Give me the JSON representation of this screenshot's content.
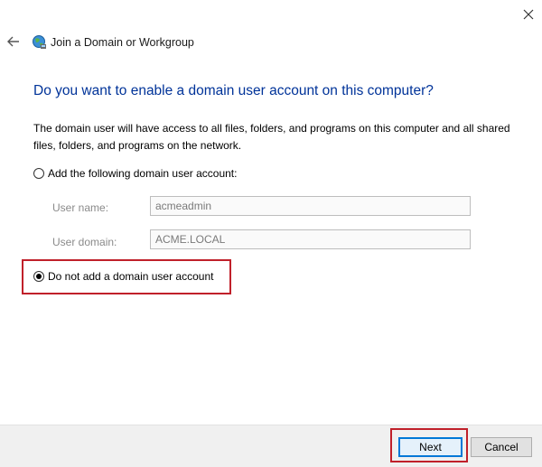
{
  "window": {
    "title": "Join a Domain or Workgroup",
    "close_icon": "close-icon",
    "back_icon": "back-arrow-icon",
    "app_icon": "network-globe-icon"
  },
  "heading": "Do you want to enable a domain user account on this computer?",
  "description": "The domain user will have access to all files, folders, and programs on this computer and all shared files, folders, and programs on the network.",
  "options": {
    "add_account": {
      "label": "Add the following domain user account:",
      "selected": false
    },
    "no_account": {
      "label": "Do not add a domain user account",
      "selected": true
    }
  },
  "fields": {
    "username": {
      "label": "User name:",
      "value": "acmeadmin"
    },
    "domain": {
      "label": "User domain:",
      "value": "ACME.LOCAL"
    }
  },
  "buttons": {
    "next": "Next",
    "cancel": "Cancel"
  },
  "colors": {
    "heading": "#003399",
    "highlight": "#c0202a",
    "footer_bg": "#f0f0f0"
  }
}
